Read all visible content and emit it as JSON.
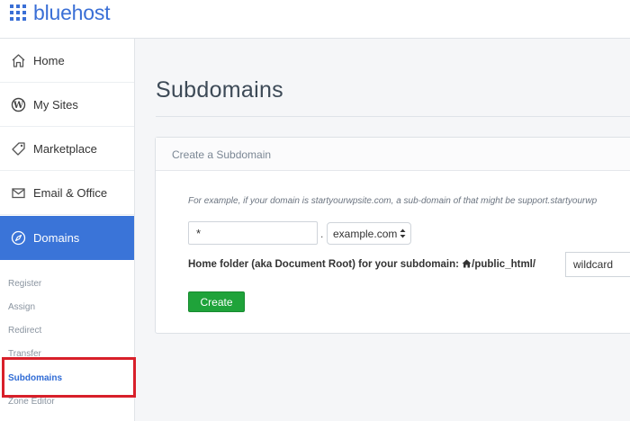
{
  "brand": {
    "name": "bluehost",
    "color": "#3a6fd6"
  },
  "sidebar": {
    "items": [
      {
        "label": "Home",
        "icon": "home-icon"
      },
      {
        "label": "My Sites",
        "icon": "wordpress-icon"
      },
      {
        "label": "Marketplace",
        "icon": "tag-icon"
      },
      {
        "label": "Email & Office",
        "icon": "envelope-icon"
      },
      {
        "label": "Domains",
        "icon": "compass-icon",
        "active": true
      }
    ],
    "subitems": [
      {
        "label": "Register"
      },
      {
        "label": "Assign"
      },
      {
        "label": "Redirect"
      },
      {
        "label": "Transfer"
      },
      {
        "label": "Subdomains",
        "active": true
      },
      {
        "label": "Zone Editor"
      }
    ],
    "active_color": "#3a74d8"
  },
  "main": {
    "title": "Subdomains",
    "panel": {
      "header": "Create a Subdomain",
      "example_parts": {
        "p1": "For example, if your domain is ",
        "domain": "startyourwpsite.com",
        "p2": ", a ",
        "sub": "sub-domain",
        "p3": " of that might be ",
        "result": "support.startyourwp"
      },
      "subdomain_value": "*",
      "dot": ".",
      "domain_selected": "example.com",
      "home_folder_label": "Home folder (aka Document Root) for your subdomain: ",
      "home_folder_path": "/public_html/",
      "folder_value": "wildcard",
      "create_label": "Create",
      "create_color": "#1fa33a"
    }
  },
  "annotation": {
    "highlight_color": "#d8202a"
  }
}
